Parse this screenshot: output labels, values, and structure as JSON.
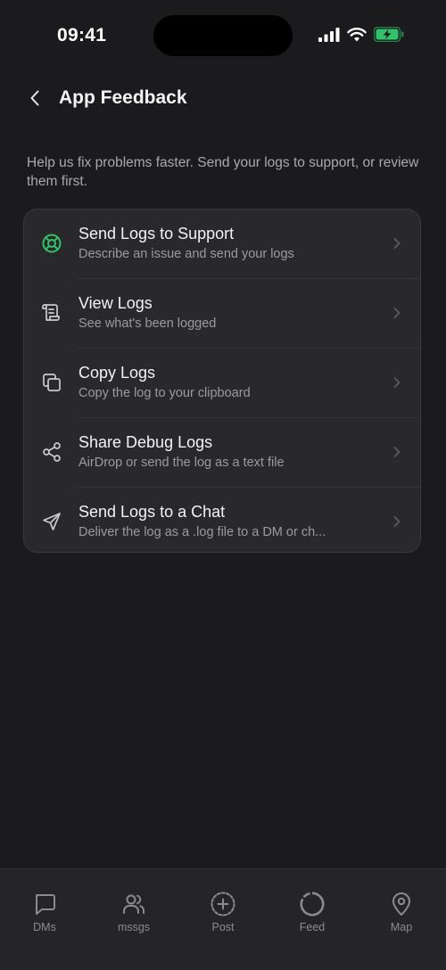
{
  "status_bar": {
    "time": "09:41"
  },
  "header": {
    "title": "App Feedback"
  },
  "description": "Help us fix problems faster. Send your logs to support, or review them first.",
  "colors": {
    "accent_green": "#32c36a",
    "background": "#1b1b1e",
    "card": "#29292c"
  },
  "options": [
    {
      "title": "Send Logs to Support",
      "subtitle": "Describe an issue and send your logs",
      "icon": "lifebuoy-icon"
    },
    {
      "title": "View Logs",
      "subtitle": "See what's been logged",
      "icon": "scroll-icon"
    },
    {
      "title": "Copy Logs",
      "subtitle": "Copy the log to your clipboard",
      "icon": "copy-icon"
    },
    {
      "title": "Share Debug Logs",
      "subtitle": "AirDrop or send the log as a text file",
      "icon": "share-icon"
    },
    {
      "title": "Send Logs to a Chat",
      "subtitle": "Deliver the log as a .log file to a DM or ch...",
      "icon": "send-icon"
    }
  ],
  "tabs": [
    {
      "label": "DMs",
      "icon": "chat-bubble-icon"
    },
    {
      "label": "mssgs",
      "icon": "people-icon"
    },
    {
      "label": "Post",
      "icon": "plus-circle-icon"
    },
    {
      "label": "Feed",
      "icon": "circle-icon"
    },
    {
      "label": "Map",
      "icon": "map-pin-icon"
    }
  ]
}
